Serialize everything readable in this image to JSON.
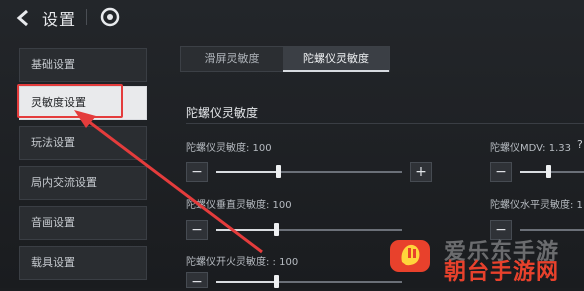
{
  "header": {
    "title": "设置"
  },
  "sidebar": {
    "items": [
      {
        "label": "基础设置"
      },
      {
        "label": "灵敏度设置"
      },
      {
        "label": "玩法设置"
      },
      {
        "label": "局内交流设置"
      },
      {
        "label": "音画设置"
      },
      {
        "label": "载具设置"
      }
    ],
    "active_index": 1
  },
  "tabs": [
    {
      "label": "滑屏灵敏度"
    },
    {
      "label": "陀螺仪灵敏度"
    }
  ],
  "section": {
    "title": "陀螺仪灵敏度"
  },
  "settings": {
    "gyro": {
      "label": "陀螺仪灵敏度: 100",
      "value": 100
    },
    "gyro_mdv": {
      "label": "陀螺仪MDV: 1.33",
      "value": 1.33
    },
    "gyro_vertical": {
      "label": "陀螺仪垂直灵敏度: 100",
      "value": 100
    },
    "gyro_horizontal": {
      "label": "陀螺仪水平灵敏度: 1",
      "value": 1
    },
    "gyro_fire": {
      "label": "陀螺仪开火灵敏度: : 100",
      "value": 100
    }
  },
  "controls": {
    "minus": "−",
    "plus": "+",
    "help": "?"
  },
  "watermark": {
    "line1": "爱乐东手游",
    "line2": "朝台手游网"
  },
  "colors": {
    "annotation": "#e43c3c",
    "watermark_red": "#e8412c"
  }
}
